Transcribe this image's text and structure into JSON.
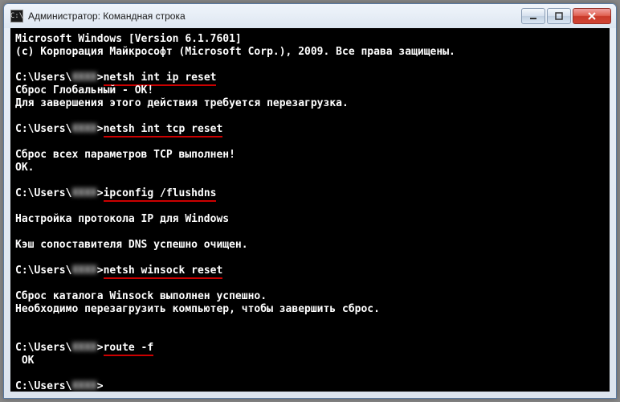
{
  "window": {
    "icon_label": "C:\\",
    "title": "Администратор: Командная строка"
  },
  "terminal": {
    "header_version": "Microsoft Windows [Version 6.1.7601]",
    "header_copyright": "(c) Корпорация Майкрософт (Microsoft Corp.), 2009. Все права защищены.",
    "prompt_prefix": "C:\\Users\\",
    "prompt_user_masked": "XXXX",
    "prompt_suffix": ">",
    "blocks": [
      {
        "command": "netsh int ip reset",
        "output": [
          "Сброс Глобальный - OK!",
          "Для завершения этого действия требуется перезагрузка."
        ]
      },
      {
        "command": "netsh int tcp reset",
        "output": [
          "",
          "Сброс всех параметров TCP выполнен!",
          "OK."
        ]
      },
      {
        "command": "ipconfig /flushdns",
        "output": [
          "",
          "Настройка протокола IP для Windows",
          "",
          "Кэш сопоставителя DNS успешно очищен."
        ]
      },
      {
        "command": "netsh winsock reset",
        "output": [
          "",
          "Сброс каталога Winsock выполнен успешно.",
          "Необходимо перезагрузить компьютер, чтобы завершить сброс.",
          ""
        ]
      },
      {
        "command": "route -f",
        "output": [
          " OK"
        ]
      }
    ]
  }
}
